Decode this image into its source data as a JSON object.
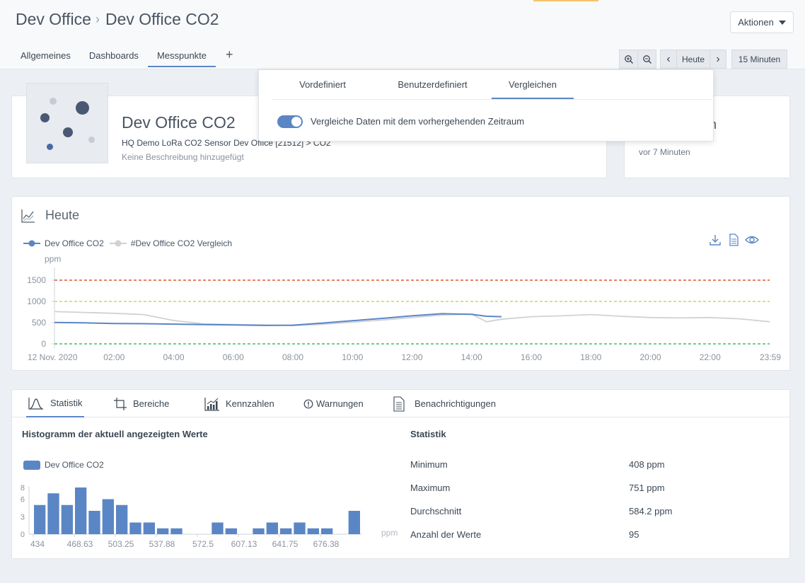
{
  "breadcrumb": {
    "parent": "Dev Office",
    "current": "Dev Office CO2"
  },
  "actions_label": "Aktionen",
  "tabs": [
    {
      "label": "Allgemeines",
      "active": false
    },
    {
      "label": "Dashboards",
      "active": false
    },
    {
      "label": "Messpunkte",
      "active": true
    }
  ],
  "timebar": {
    "today_label": "Heute",
    "interval_label": "15 Minuten"
  },
  "popover": {
    "tabs": [
      {
        "label": "Vordefiniert",
        "active": false
      },
      {
        "label": "Benutzerdefiniert",
        "active": false
      },
      {
        "label": "Vergleichen",
        "active": true
      }
    ],
    "toggle_on": true,
    "toggle_label": "Vergleiche Daten mit dem vorhergehenden Zeitraum"
  },
  "device": {
    "title": "Dev Office CO2",
    "path": "HQ Demo LoRa CO2 Sensor Dev Office [21512] > CO2",
    "description": "Keine Beschreibung hinzugefügt"
  },
  "side_card": {
    "partial_title": "n",
    "updated": "vor 7 Minuten"
  },
  "chart_section": {
    "title": "Heute",
    "legend": [
      "Dev Office CO2",
      "#Dev Office CO2 Vergleich"
    ],
    "icons": [
      "download-icon",
      "document-icon",
      "eye-icon"
    ]
  },
  "chart_data": [
    {
      "type": "line",
      "ylabel": "ppm",
      "ylim": [
        0,
        1600
      ],
      "yticks": [
        0,
        500,
        1000,
        1500
      ],
      "xticks": [
        "12 Nov. 2020",
        "02:00",
        "04:00",
        "06:00",
        "08:00",
        "10:00",
        "12:00",
        "14:00",
        "16:00",
        "18:00",
        "20:00",
        "22:00",
        "23:59"
      ],
      "thresholds": [
        {
          "value": 1500,
          "color": "#e4572e"
        },
        {
          "value": 1000,
          "color": "#b5e34a"
        },
        {
          "value": 0,
          "color": "#3fbf5f"
        }
      ],
      "series": [
        {
          "name": "Dev Office CO2",
          "color": "#5b86c5",
          "x": [
            0,
            1,
            2,
            3,
            4,
            5,
            6,
            7,
            8,
            9,
            10,
            11,
            12,
            13,
            14,
            14.5,
            15
          ],
          "y": [
            505,
            495,
            480,
            475,
            465,
            455,
            445,
            435,
            440,
            490,
            545,
            600,
            660,
            710,
            695,
            650,
            640
          ]
        },
        {
          "name": "#Dev Office CO2 Vergleich",
          "color": "#cfd2d6",
          "x": [
            0,
            1,
            2,
            3,
            4,
            5,
            6,
            7,
            8,
            9,
            10,
            11,
            12,
            13,
            14,
            14.5,
            15,
            16,
            17,
            18,
            19,
            20,
            21,
            22,
            23,
            24
          ],
          "y": [
            760,
            740,
            720,
            690,
            550,
            470,
            455,
            445,
            430,
            460,
            510,
            560,
            620,
            680,
            700,
            520,
            580,
            640,
            660,
            690,
            650,
            620,
            610,
            620,
            590,
            520
          ]
        }
      ]
    },
    {
      "type": "bar",
      "title": "Histogramm der aktuell angezeigten Werte",
      "series_name": "Dev Office CO2",
      "unit": "ppm",
      "ylim": [
        0,
        8
      ],
      "yticks": [
        0,
        3,
        6,
        8
      ],
      "xticks": [
        "434",
        "468.63",
        "503.25",
        "537.88",
        "572.5",
        "607.13",
        "641.75",
        "676.38"
      ],
      "values": [
        5,
        7,
        5,
        8,
        4,
        6,
        5,
        2,
        2,
        1,
        1,
        0,
        0,
        2,
        1,
        0,
        1,
        2,
        1,
        2,
        1,
        1,
        0,
        4
      ]
    }
  ],
  "stats_tabs": [
    {
      "label": "Statistik",
      "icon": "bell-curve-icon",
      "active": true
    },
    {
      "label": "Bereiche",
      "icon": "crop-icon",
      "active": false
    },
    {
      "label": "Kennzahlen",
      "icon": "bar-chart-icon",
      "active": false
    },
    {
      "label": "Warnungen",
      "icon": "alert-icon",
      "active": false
    },
    {
      "label": "Benachrichtigungen",
      "icon": "document-icon",
      "active": false
    }
  ],
  "stats": {
    "title": "Statistik",
    "rows": [
      {
        "label": "Minimum",
        "value": "408 ppm"
      },
      {
        "label": "Maximum",
        "value": "751 ppm"
      },
      {
        "label": "Durchschnitt",
        "value": "584.2 ppm"
      },
      {
        "label": "Anzahl der Werte",
        "value": "95"
      }
    ]
  }
}
